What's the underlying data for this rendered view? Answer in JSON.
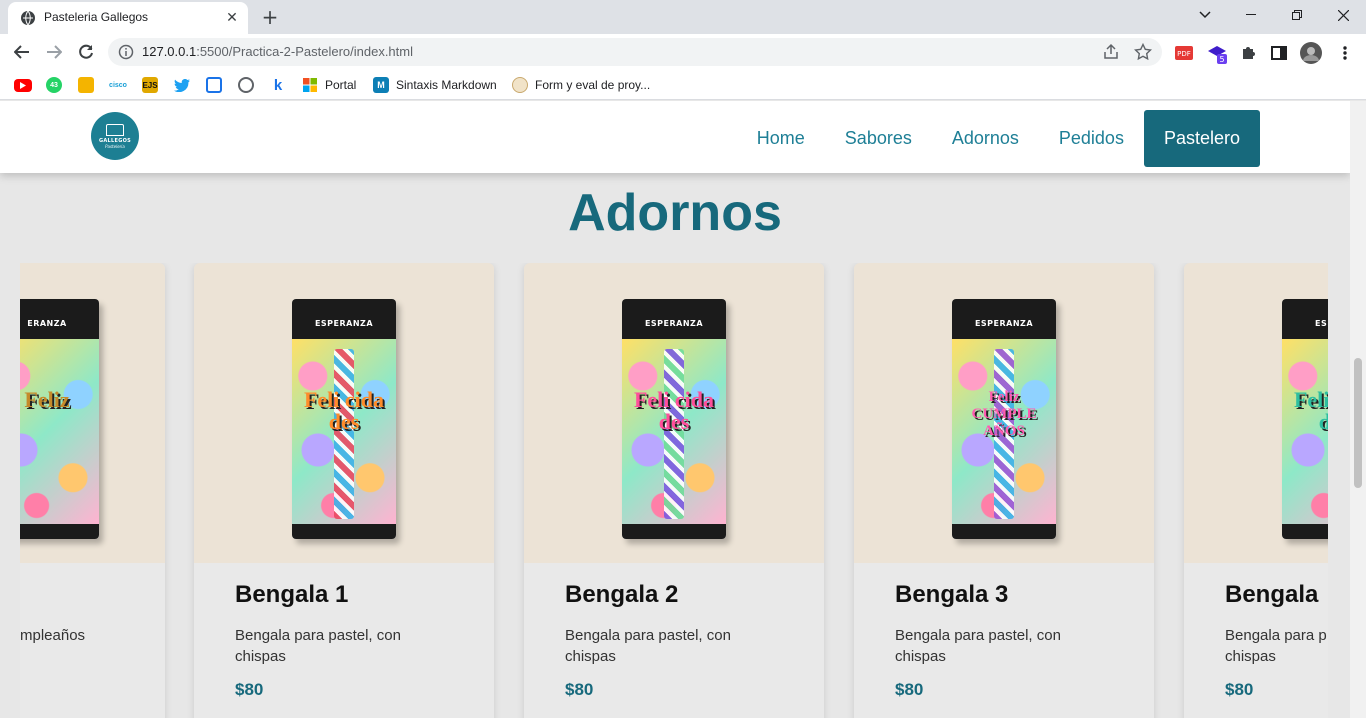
{
  "browser": {
    "tab_title": "Pasteleria Gallegos",
    "url_host": "127.0.0.1",
    "url_rest": ":5500/Practica-2-Pastelero/index.html",
    "extension_badge": "5",
    "bookmarks": [
      {
        "label": "",
        "icon": "youtube-icon",
        "color": "#ff0000"
      },
      {
        "label": "",
        "icon": "whatsapp-icon",
        "color": "#25d366",
        "badge": "43"
      },
      {
        "label": "",
        "icon": "pencil-icon",
        "color": "#f4b400"
      },
      {
        "label": "",
        "icon": "cisco-icon",
        "color": "#1ba0d7"
      },
      {
        "label": "",
        "icon": "ejs-icon",
        "color": "#e0a800",
        "text": "EJS"
      },
      {
        "label": "",
        "icon": "twitter-icon",
        "color": "#1da1f2"
      },
      {
        "label": "",
        "icon": "calendar-icon",
        "color": "#1a73e8"
      },
      {
        "label": "",
        "icon": "globe-icon",
        "color": "#5f6368"
      },
      {
        "label": "",
        "icon": "k-icon",
        "color": "#1a73e8",
        "text": "k"
      },
      {
        "label": "Portal",
        "icon": "microsoft-icon",
        "color": "#f25022"
      },
      {
        "label": "Sintaxis Markdown",
        "icon": "markdown-icon",
        "color": "#0d7fb5"
      },
      {
        "label": "Form y eval de proy...",
        "icon": "seal-icon",
        "color": "#c9a96e"
      }
    ]
  },
  "site": {
    "logo_text": "GALLEGOS",
    "logo_sub": "Pasteleria",
    "nav": [
      "Home",
      "Sabores",
      "Adornos",
      "Pedidos",
      "Pastelero"
    ],
    "section_title": "Adornos"
  },
  "cards": [
    {
      "name": "",
      "desc": "mpleaños",
      "price": "",
      "pkg_label": "ERANZA",
      "pkg_word": "Feliz"
    },
    {
      "name": "Bengala 1",
      "desc": "Bengala para pastel, con chispas",
      "price": "$80",
      "pkg_label": "ESPERANZA",
      "pkg_word": "Feli cida des"
    },
    {
      "name": "Bengala 2",
      "desc": "Bengala para pastel, con chispas",
      "price": "$80",
      "pkg_label": "ESPERANZA",
      "pkg_word": "Feli cida des"
    },
    {
      "name": "Bengala 3",
      "desc": "Bengala para pastel, con chispas",
      "price": "$80",
      "pkg_label": "ESPERANZA",
      "pkg_word": "Feliz CUMPLE AÑOS"
    },
    {
      "name": "Bengala",
      "desc": "Bengala para p chispas",
      "price": "$80",
      "pkg_label": "ESPERA",
      "pkg_word": "Feli cida des"
    }
  ],
  "colors": {
    "accent": "#17697c",
    "link": "#1e7f96",
    "card_bg": "#e9e9e9",
    "photo_bg": "#ece3d6"
  }
}
